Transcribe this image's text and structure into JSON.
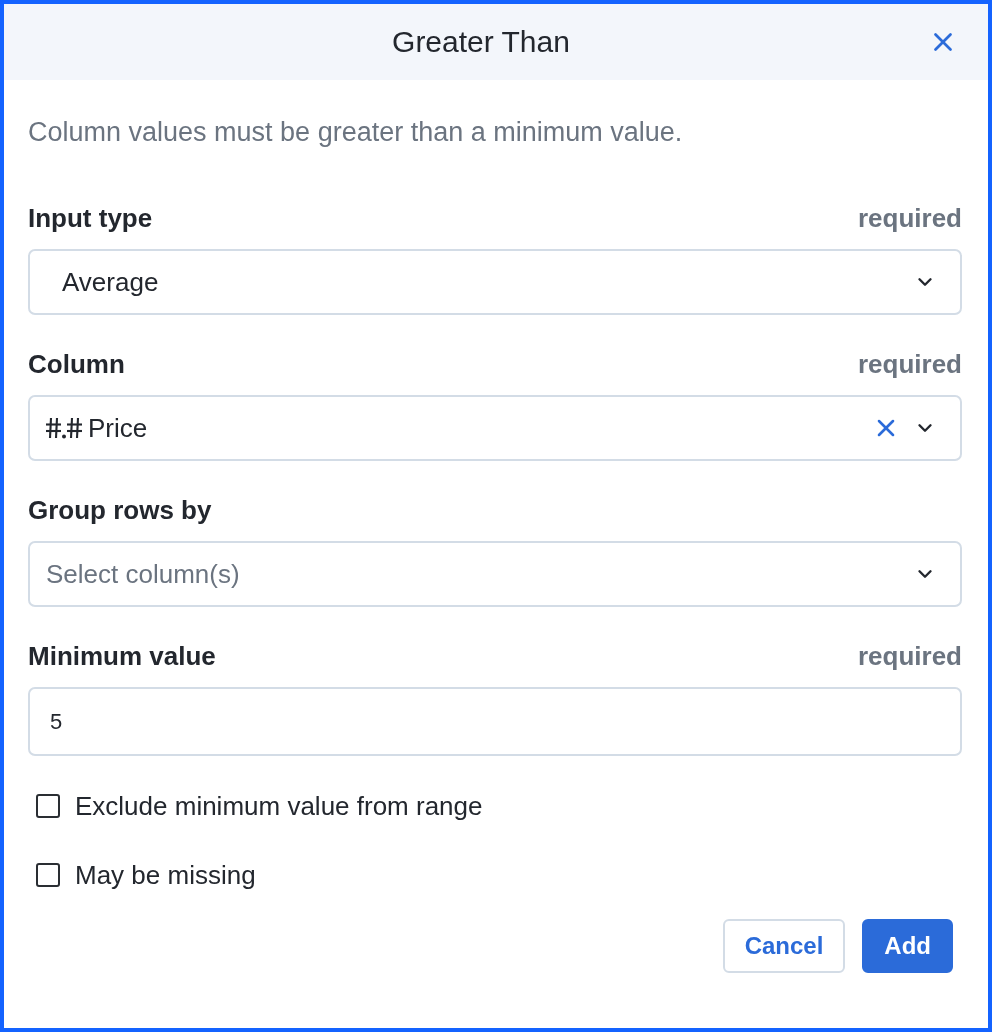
{
  "dialog": {
    "title": "Greater Than",
    "description": "Column values must be greater than a minimum value."
  },
  "fields": [
    {
      "kind": "select",
      "label": "Input type",
      "note": "required",
      "value": "Average",
      "show_type_icon": false,
      "clearable": false
    },
    {
      "kind": "select",
      "label": "Column",
      "note": "required",
      "value": "Price",
      "show_type_icon": true,
      "clearable": true
    },
    {
      "kind": "select",
      "label": "Group rows by",
      "placeholder": "Select column(s)",
      "clearable": false
    },
    {
      "kind": "text",
      "label": "Minimum value",
      "note": "required",
      "value": "5"
    }
  ],
  "checkboxes": [
    {
      "label": "Exclude minimum value from range",
      "checked": false
    },
    {
      "label": "May be missing",
      "checked": false
    }
  ],
  "buttons": [
    {
      "label": "Cancel",
      "kind": "secondary"
    },
    {
      "label": "Add",
      "kind": "primary"
    }
  ]
}
